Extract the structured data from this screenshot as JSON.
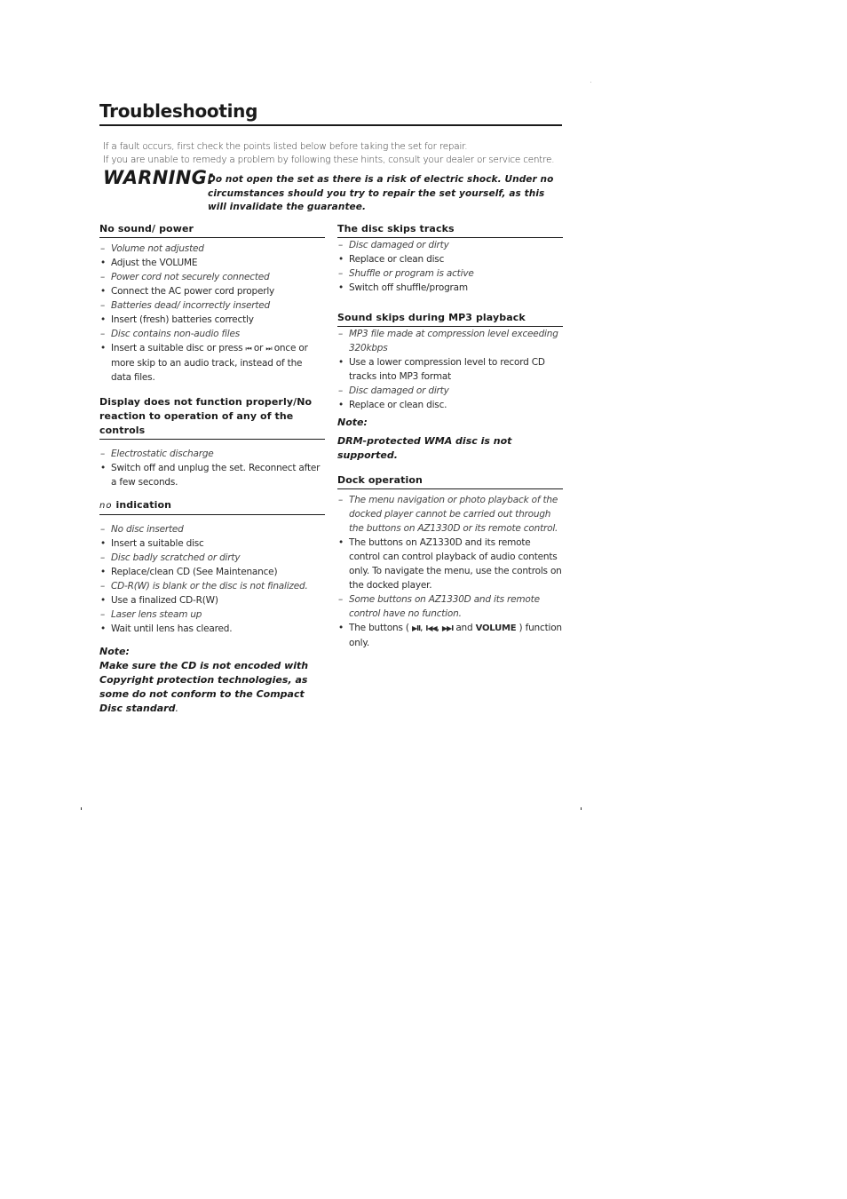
{
  "page": {
    "title": "Troubleshooting",
    "intro": [
      "If a fault occurs, first check the points listed below before taking the set for repair.",
      "If you are unable to remedy a problem by following these hints, consult your dealer or service centre."
    ],
    "warning": {
      "label": "WARNING:",
      "text": "Do not open the set as there is a risk of electric shock. Under no circumstances should you try to repair the set yourself, as this will invalidate the guarantee."
    }
  },
  "left_column": {
    "no_sound": {
      "heading": "No sound/ power",
      "items": [
        {
          "type": "cause",
          "marker": "–",
          "text": "Volume not adjusted"
        },
        {
          "type": "remedy",
          "marker": "•",
          "text": "Adjust the VOLUME"
        },
        {
          "type": "cause",
          "marker": "–",
          "text": "Power cord not securely connected"
        },
        {
          "type": "remedy",
          "marker": "•",
          "text": "Connect the AC power cord properly"
        },
        {
          "type": "cause",
          "marker": "–",
          "text": "Batteries dead/ incorrectly inserted"
        },
        {
          "type": "remedy",
          "marker": "•",
          "text": "Insert (fresh) batteries correctly"
        },
        {
          "type": "cause",
          "marker": "–",
          "text": "Disc contains non-audio files"
        }
      ],
      "last_remedy": {
        "marker": "•",
        "before": "Insert a suitable disc or press ",
        "prev_icon": "⏮",
        "middle": " or ",
        "next_icon": "⏭",
        "after": " once or more skip to an audio track, instead of the data files."
      }
    },
    "display": {
      "heading": "Display does not function properly/No reaction to operation of any of the controls",
      "items": [
        {
          "type": "cause",
          "marker": "–",
          "text": "Electrostatic discharge"
        },
        {
          "type": "remedy",
          "marker": "•",
          "text": "Switch off and unplug the set. Reconnect after a few seconds."
        }
      ]
    },
    "no_indication": {
      "icon": "no",
      "heading": "indication",
      "items": [
        {
          "type": "cause",
          "marker": "–",
          "text": "No disc inserted"
        },
        {
          "type": "remedy",
          "marker": "•",
          "text": "Insert a suitable disc"
        },
        {
          "type": "cause",
          "marker": "–",
          "text": "Disc badly scratched or dirty"
        },
        {
          "type": "remedy",
          "marker": "•",
          "text": "Replace/clean CD (See Maintenance)"
        },
        {
          "type": "cause",
          "marker": "–",
          "text": "CD-R(W) is blank or the disc is not finalized."
        },
        {
          "type": "remedy",
          "marker": "•",
          "text": "Use a finalized CD-R(W)"
        },
        {
          "type": "cause",
          "marker": "–",
          "text": "Laser lens steam up"
        },
        {
          "type": "remedy",
          "marker": "•",
          "text": "Wait until lens has cleared."
        }
      ]
    },
    "note": {
      "label": "Note:",
      "text": "Make sure the CD is not encoded with Copyright protection technologies, as some do not conform to the Compact Disc standard",
      "tail": "."
    }
  },
  "right_column": {
    "disc_skips": {
      "heading": "The disc skips tracks",
      "items": [
        {
          "type": "cause",
          "marker": "–",
          "text": "Disc damaged or dirty"
        },
        {
          "type": "remedy",
          "marker": "•",
          "text": "Replace or clean disc"
        },
        {
          "type": "cause",
          "marker": "–",
          "text": "Shuffle or program is active"
        },
        {
          "type": "remedy",
          "marker": "•",
          "text": "Switch off shuffle/program"
        }
      ]
    },
    "mp3_skips": {
      "heading": "Sound skips during MP3 playback",
      "items": [
        {
          "type": "cause",
          "marker": "–",
          "text": "MP3 file made at compression level exceeding 320kbps"
        },
        {
          "type": "remedy",
          "marker": "•",
          "text": "Use a lower compression level to record CD tracks into MP3 format"
        },
        {
          "type": "cause",
          "marker": "–",
          "text": "Disc damaged or dirty"
        },
        {
          "type": "remedy",
          "marker": "•",
          "text": "Replace or clean disc."
        }
      ]
    },
    "note": {
      "label": "Note:",
      "text": "DRM-protected WMA disc is not supported."
    },
    "dock": {
      "heading": "Dock operation",
      "items": [
        {
          "type": "cause",
          "marker": "–",
          "text": "The menu navigation or photo playback of the docked player cannot be carried out through the buttons on AZ1330D or its remote control."
        },
        {
          "type": "remedy",
          "marker": "•",
          "text": "The buttons on AZ1330D and its remote control can control playback of audio contents only. To navigate the menu, use the controls on the docked player."
        },
        {
          "type": "cause",
          "marker": "–",
          "text": "Some buttons on AZ1330D and its remote control have no function."
        }
      ],
      "last_remedy": {
        "marker": "•",
        "before": "The buttons ( ",
        "play_pause_icon": "▶II",
        "sep1": ", ",
        "prev_icon": "I◀◀",
        "sep2": ", ",
        "next_icon": "▶▶I",
        "and": " and ",
        "volume": "VOLUME",
        "after": " ) function only."
      }
    }
  }
}
